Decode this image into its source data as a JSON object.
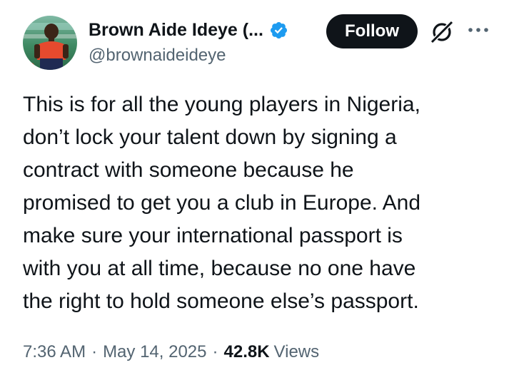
{
  "author": {
    "display_name": "Brown Aide Ideye (...",
    "handle": "@brownaideideye",
    "verified": true
  },
  "actions": {
    "follow_label": "Follow",
    "grok_icon": "grok-icon",
    "more_icon": "more-options-icon"
  },
  "tweet": {
    "text": "This is for all the young players in Nigeria,\ndon’t lock your talent down by signing a\ncontract with someone because he\npromised to get you a club in Europe. And\nmake sure your international passport is\nwith you at all time, because no one have\nthe right to hold someone else’s passport."
  },
  "meta": {
    "time": "7:36 AM",
    "separator": "·",
    "date": "May 14, 2025",
    "views_count": "42.8K",
    "views_label": "Views"
  },
  "colors": {
    "text_primary": "#0f1419",
    "text_secondary": "#536471",
    "verified_blue": "#1d9bf0",
    "follow_bg": "#0f1419"
  }
}
